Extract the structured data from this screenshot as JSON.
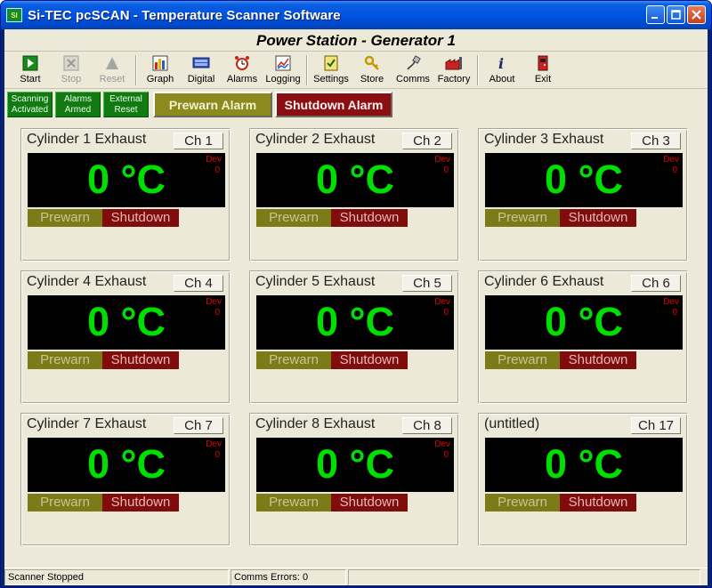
{
  "window": {
    "title": "Si-TEC pcSCAN - Temperature Scanner Software",
    "icon_text": "SI"
  },
  "header": {
    "title": "Power Station - Generator 1"
  },
  "toolbar": {
    "start": "Start",
    "stop": "Stop",
    "reset": "Reset",
    "graph": "Graph",
    "digital": "Digital",
    "alarms": "Alarms",
    "logging": "Logging",
    "settings": "Settings",
    "store": "Store",
    "comms": "Comms",
    "factory": "Factory",
    "about": "About",
    "exit": "Exit"
  },
  "indicators": {
    "scanning": "Scanning Activated",
    "alarms_armed": "Alarms Armed",
    "external_reset": "External Reset",
    "prewarn_alarm": "Prewarn Alarm",
    "shutdown_alarm": "Shutdown Alarm"
  },
  "channels": [
    {
      "name": "Cylinder 1 Exhaust",
      "ch": "Ch 1",
      "temp": "0 °C",
      "dev_label": "Dev",
      "dev": "0",
      "prewarn": "Prewarn",
      "shutdown": "Shutdown"
    },
    {
      "name": "Cylinder 2 Exhaust",
      "ch": "Ch 2",
      "temp": "0 °C",
      "dev_label": "Dev",
      "dev": "0",
      "prewarn": "Prewarn",
      "shutdown": "Shutdown"
    },
    {
      "name": "Cylinder 3 Exhaust",
      "ch": "Ch 3",
      "temp": "0 °C",
      "dev_label": "Dev",
      "dev": "0",
      "prewarn": "Prewarn",
      "shutdown": "Shutdown"
    },
    {
      "name": "Cylinder 4 Exhaust",
      "ch": "Ch 4",
      "temp": "0 °C",
      "dev_label": "Dev",
      "dev": "0",
      "prewarn": "Prewarn",
      "shutdown": "Shutdown"
    },
    {
      "name": "Cylinder 5 Exhaust",
      "ch": "Ch 5",
      "temp": "0 °C",
      "dev_label": "Dev",
      "dev": "0",
      "prewarn": "Prewarn",
      "shutdown": "Shutdown"
    },
    {
      "name": "Cylinder 6 Exhaust",
      "ch": "Ch 6",
      "temp": "0 °C",
      "dev_label": "Dev",
      "dev": "0",
      "prewarn": "Prewarn",
      "shutdown": "Shutdown"
    },
    {
      "name": "Cylinder 7 Exhaust",
      "ch": "Ch 7",
      "temp": "0 °C",
      "dev_label": "Dev",
      "dev": "0",
      "prewarn": "Prewarn",
      "shutdown": "Shutdown"
    },
    {
      "name": "Cylinder 8 Exhaust",
      "ch": "Ch 8",
      "temp": "0 °C",
      "dev_label": "Dev",
      "dev": "0",
      "prewarn": "Prewarn",
      "shutdown": "Shutdown"
    },
    {
      "name": "(untitled)",
      "ch": "Ch 17",
      "temp": "0 °C",
      "dev_label": "",
      "dev": "",
      "prewarn": "Prewarn",
      "shutdown": "Shutdown"
    }
  ],
  "statusbar": {
    "scanner": "Scanner Stopped",
    "comms": "Comms Errors: 0"
  },
  "colors": {
    "temp_text": "#00e000",
    "prewarn": "#7d7b18",
    "shutdown": "#800c0c",
    "indicator_green": "#127a12"
  }
}
